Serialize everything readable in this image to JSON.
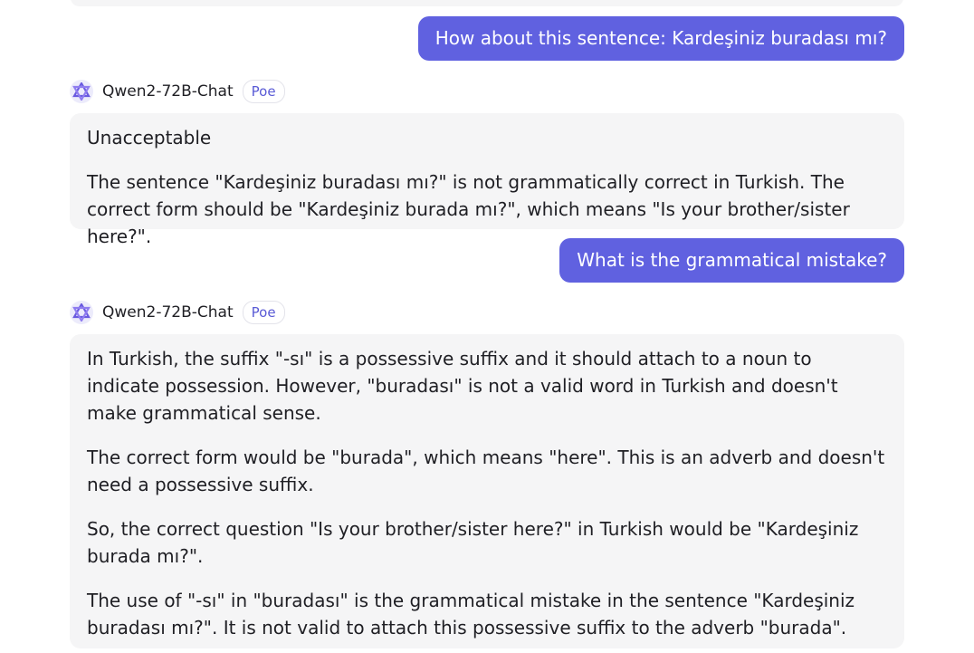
{
  "messages": {
    "user_1": "How about this sentence: Kardeşiniz buradası mı?",
    "bot_1": {
      "name": "Qwen2-72B-Chat",
      "badge": "Poe",
      "paragraphs": [
        "Unacceptable",
        "The sentence \"Kardeşiniz buradası mı?\" is not grammatically correct in Turkish. The correct form should be \"Kardeşiniz burada mı?\", which means \"Is your brother/sister here?\"."
      ]
    },
    "user_2": "What is the grammatical mistake?",
    "bot_2": {
      "name": "Qwen2-72B-Chat",
      "badge": "Poe",
      "paragraphs": [
        "In Turkish, the suffix \"-sı\" is a possessive suffix and it should attach to a noun to indicate possession. However, \"buradası\" is not a valid word in Turkish and doesn't make grammatical sense.",
        "The correct form would be \"burada\", which means \"here\". This is an adverb and doesn't need a possessive suffix.",
        "So, the correct question \"Is your brother/sister here?\" in Turkish would be \"Kardeşiniz burada mı?\".",
        "The use of \"-sı\" in \"buradası\" is the grammatical mistake in the sentence \"Kardeşiniz buradası mı?\". It is not valid to attach this possessive suffix to the adverb \"burada\"."
      ]
    }
  },
  "icons": {
    "bot_avatar": "qwen-logo-icon"
  },
  "colors": {
    "user_bubble": "#6061e0",
    "bot_bubble": "#f5f5f6",
    "badge_text": "#5a5bd6"
  }
}
